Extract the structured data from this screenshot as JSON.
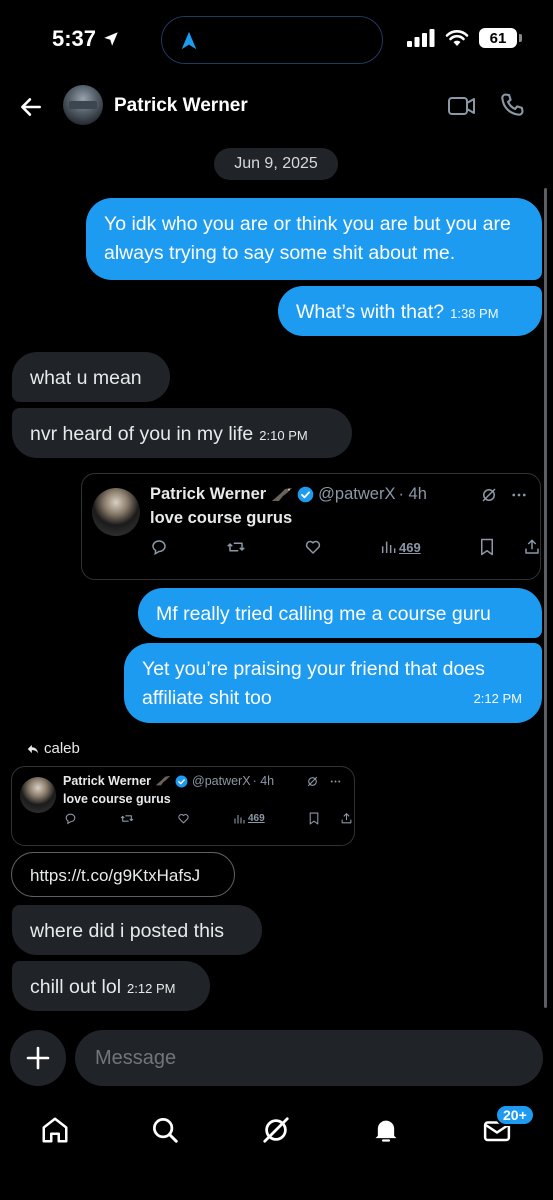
{
  "status_bar": {
    "time": "5:37",
    "battery": "61"
  },
  "header": {
    "contact_name": "Patrick Werner"
  },
  "date_separator": "Jun 9, 2025",
  "messages": [
    {
      "text": "Yo idk who you are or think you are but you are always trying to say some shit about me.",
      "time": ""
    },
    {
      "text": "What’s with that?",
      "time": "1:38 PM"
    },
    {
      "text": "what u mean",
      "time": ""
    },
    {
      "text": "nvr heard of you in my life",
      "time": "2:10 PM"
    },
    {
      "text": "Mf really tried calling me a course guru",
      "time": ""
    },
    {
      "text": "Yet you’re praising your friend that does affiliate shit too",
      "time": "2:12 PM"
    },
    {
      "text": "https://t.co/g9KtxHafsJ",
      "time": ""
    },
    {
      "text": "where did i posted this",
      "time": ""
    },
    {
      "text": "chill out lol",
      "time": "2:12 PM"
    }
  ],
  "tweet": {
    "author": "Patrick Werner",
    "handle": "@patwerX",
    "age": "· 4h",
    "text": "love course gurus",
    "views": "469"
  },
  "reply_to": "caleb",
  "composer": {
    "placeholder": "Message"
  },
  "tabbar": {
    "messages_badge": "20+"
  },
  "colors": {
    "accent": "#1d9bf0",
    "received_bubble": "#202327",
    "background": "#000000"
  }
}
